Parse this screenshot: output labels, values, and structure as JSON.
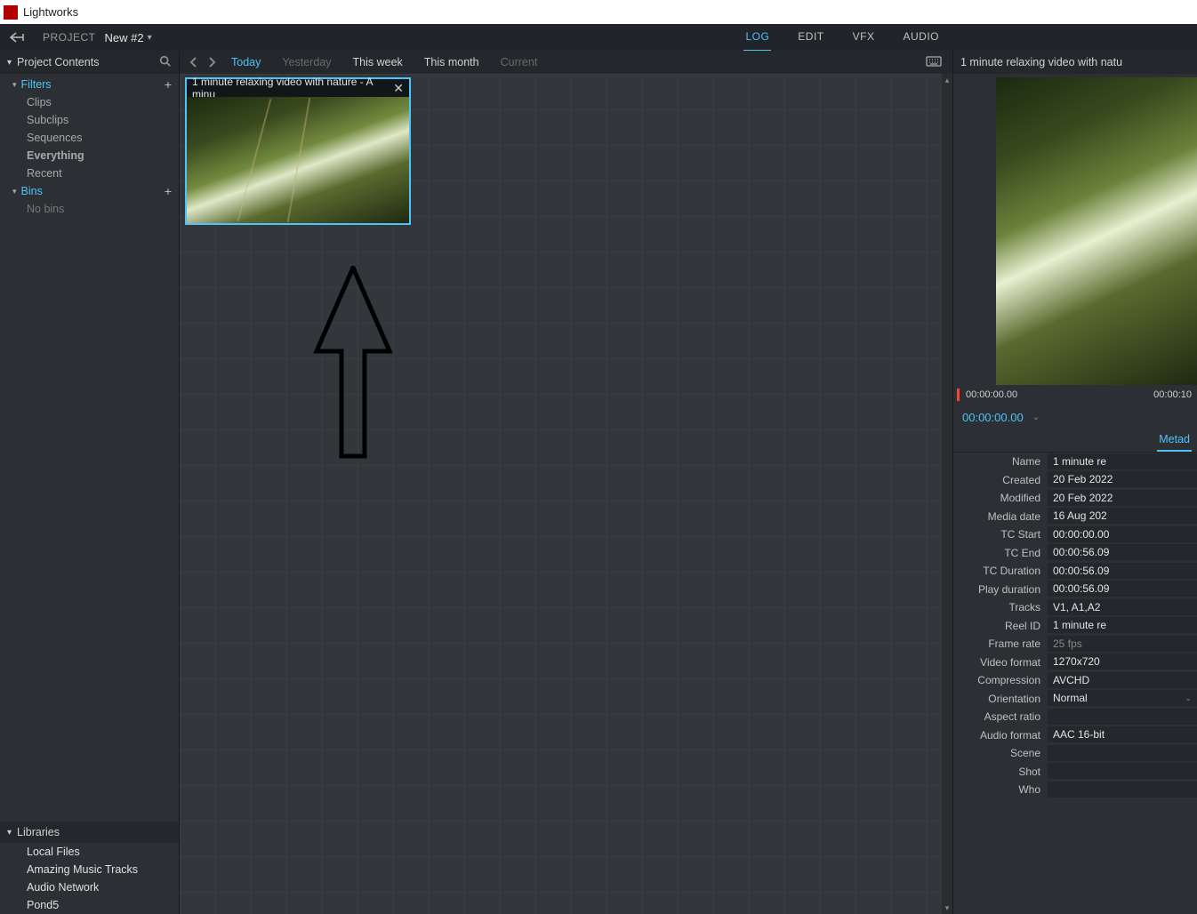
{
  "app_title": "Lightworks",
  "topnav": {
    "project_label": "PROJECT",
    "project_name": "New #2",
    "tabs": [
      "LOG",
      "EDIT",
      "VFX",
      "AUDIO"
    ],
    "active_tab": "LOG"
  },
  "sidebar": {
    "title": "Project Contents",
    "filters_label": "Filters",
    "filters": [
      {
        "label": "Clips"
      },
      {
        "label": "Subclips"
      },
      {
        "label": "Sequences"
      },
      {
        "label": "Everything",
        "bold": true
      },
      {
        "label": "Recent",
        "sel": true
      }
    ],
    "bins_label": "Bins",
    "no_bins": "No bins",
    "libraries_label": "Libraries",
    "libraries": [
      "Local Files",
      "Amazing Music Tracks",
      "Audio Network",
      "Pond5"
    ]
  },
  "filterbar": {
    "items": [
      {
        "label": "Today",
        "cls": "active"
      },
      {
        "label": "Yesterday",
        "cls": "dim"
      },
      {
        "label": "This week",
        "cls": "norm"
      },
      {
        "label": "This month",
        "cls": "norm"
      },
      {
        "label": "Current",
        "cls": "dim"
      }
    ]
  },
  "clip": {
    "title": "1 minute relaxing video with nature - A minu"
  },
  "inspector": {
    "title": "1 minute relaxing video with natu",
    "tc_start": "00:00:00.00",
    "tc_end": "00:00:10",
    "current_tc": "00:00:00.00",
    "meta_tab": "Metad",
    "rows": [
      {
        "k": "Name",
        "v": "1 minute re"
      },
      {
        "k": "Created",
        "v": "20 Feb 2022"
      },
      {
        "k": "Modified",
        "v": "20 Feb 2022"
      },
      {
        "k": "Media date",
        "v": "16 Aug 202"
      },
      {
        "k": "TC Start",
        "v": "00:00:00.00"
      },
      {
        "k": "TC End",
        "v": "00:00:56.09"
      },
      {
        "k": "TC Duration",
        "v": "00:00:56.09"
      },
      {
        "k": "Play duration",
        "v": "00:00:56.09"
      },
      {
        "k": "Tracks",
        "v": "V1, A1,A2"
      },
      {
        "k": "Reel ID",
        "v": "1 minute re"
      },
      {
        "k": "Frame rate",
        "v": "25 fps",
        "dim": true
      },
      {
        "k": "Video format",
        "v": "1270x720"
      },
      {
        "k": "Compression",
        "v": "AVCHD"
      },
      {
        "k": "Orientation",
        "v": "Normal",
        "dd": true
      },
      {
        "k": "Aspect ratio",
        "v": ""
      },
      {
        "k": "Audio format",
        "v": "AAC 16-bit"
      },
      {
        "k": "Scene",
        "v": ""
      },
      {
        "k": "Shot",
        "v": ""
      },
      {
        "k": "Who",
        "v": ""
      }
    ]
  }
}
